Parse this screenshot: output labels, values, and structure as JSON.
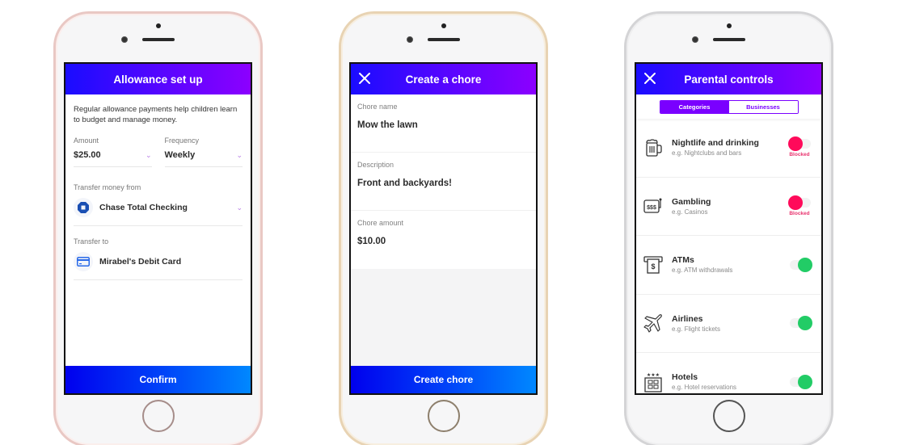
{
  "colors": {
    "header_gradient_start": "#1a0cff",
    "header_gradient_end": "#8c00ff",
    "button_gradient_start": "#0000ee",
    "button_gradient_end": "#0088ff",
    "blocked": "#ff0a5a",
    "allowed": "#22cc66",
    "accent": "#7a00ff"
  },
  "allowance": {
    "title": "Allowance set up",
    "intro": "Regular allowance payments help children learn to budget and manage money.",
    "amount_label": "Amount",
    "amount_value": "$25.00",
    "frequency_label": "Frequency",
    "frequency_value": "Weekly",
    "from_label": "Transfer money from",
    "from_value": "Chase Total Checking",
    "from_icon": "chase-bank-icon",
    "to_label": "Transfer to",
    "to_value": "Mirabel's Debit Card",
    "to_icon": "debit-card-icon",
    "confirm_label": "Confirm"
  },
  "chore": {
    "title": "Create a chore",
    "name_label": "Chore name",
    "name_value": "Mow the lawn",
    "description_label": "Description",
    "description_value": "Front and backyards!",
    "amount_label": "Chore amount",
    "amount_value": "$10.00",
    "create_label": "Create chore"
  },
  "parental": {
    "title": "Parental controls",
    "tabs": [
      {
        "label": "Categories",
        "active": true
      },
      {
        "label": "Businesses",
        "active": false
      }
    ],
    "blocked_label": "Blocked",
    "categories": [
      {
        "title": "Nightlife and drinking",
        "subtitle": "e.g. Nightclubs and bars",
        "icon": "beer-mug-icon",
        "status": "blocked"
      },
      {
        "title": "Gambling",
        "subtitle": "e.g. Casinos",
        "icon": "slot-machine-icon",
        "status": "blocked"
      },
      {
        "title": "ATMs",
        "subtitle": "e.g. ATM withdrawals",
        "icon": "atm-icon",
        "status": "allowed"
      },
      {
        "title": "Airlines",
        "subtitle": "e.g. Flight tickets",
        "icon": "airplane-icon",
        "status": "allowed"
      },
      {
        "title": "Hotels",
        "subtitle": "e.g. Hotel reservations",
        "icon": "hotel-icon",
        "status": "allowed"
      }
    ]
  }
}
